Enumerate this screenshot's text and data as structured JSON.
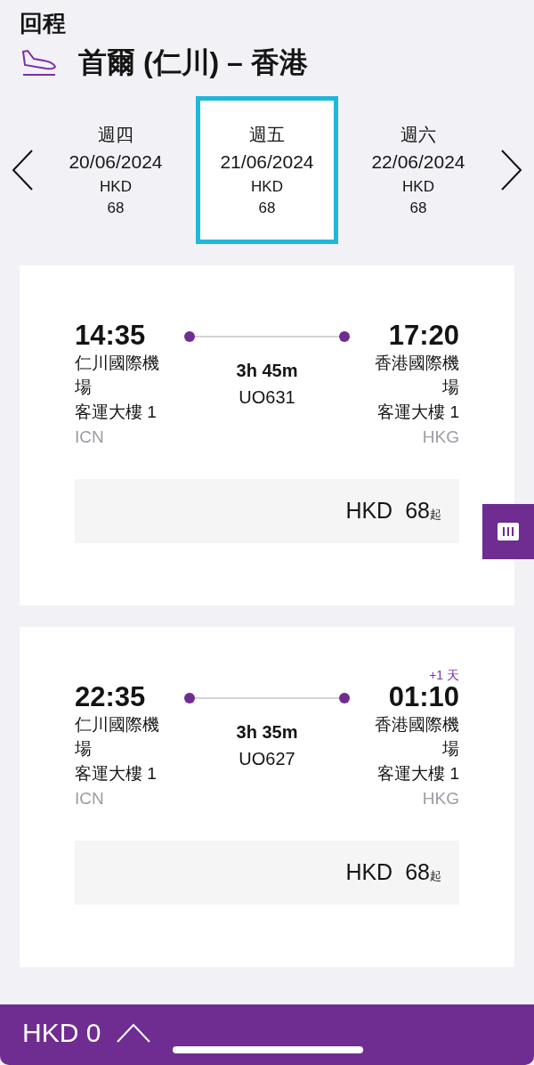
{
  "header": {
    "label": "回程",
    "route": "首爾 (仁川) – 香港"
  },
  "dates": [
    {
      "weekday": "週四",
      "date": "20/06/2024",
      "currency": "HKD",
      "price": "68",
      "selected": false
    },
    {
      "weekday": "週五",
      "date": "21/06/2024",
      "currency": "HKD",
      "price": "68",
      "selected": true
    },
    {
      "weekday": "週六",
      "date": "22/06/2024",
      "currency": "HKD",
      "price": "68",
      "selected": false
    }
  ],
  "flights": [
    {
      "depart_time": "14:35",
      "depart_airport": "仁川國際機場",
      "depart_terminal": "客運大樓 1",
      "depart_code": "ICN",
      "duration": "3h 45m",
      "flight_no": "UO631",
      "arrive_time": "17:20",
      "arrive_airport": "香港國際機場",
      "arrive_terminal": "客運大樓 1",
      "arrive_code": "HKG",
      "currency": "HKD",
      "price": "68",
      "price_suffix": "起"
    },
    {
      "day_offset": "+1 天",
      "depart_time": "22:35",
      "depart_airport": "仁川國際機場",
      "depart_terminal": "客運大樓 1",
      "depart_code": "ICN",
      "duration": "3h 35m",
      "flight_no": "UO627",
      "arrive_time": "01:10",
      "arrive_airport": "香港國際機場",
      "arrive_terminal": "客運大樓 1",
      "arrive_code": "HKG",
      "currency": "HKD",
      "price": "68",
      "price_suffix": "起"
    }
  ],
  "footer": {
    "total": "HKD 0"
  }
}
